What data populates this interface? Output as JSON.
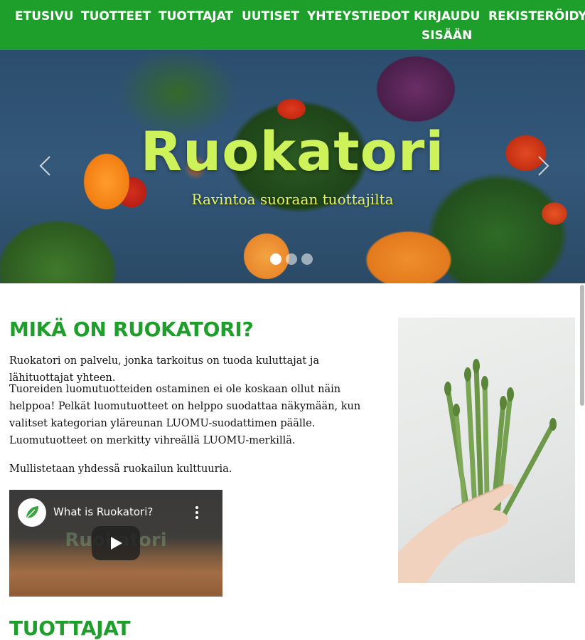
{
  "nav": {
    "items": [
      {
        "label": "ETUSIVU"
      },
      {
        "label": "TUOTTEET"
      },
      {
        "label": "TUOTTAJAT"
      },
      {
        "label": "UUTISET"
      },
      {
        "label": "YHTEYSTIEDOT"
      },
      {
        "label_line1": "KIRJAUDU",
        "label_line2": "SISÄÄN"
      },
      {
        "label": "REKISTERÖIDY"
      }
    ]
  },
  "hero": {
    "title": "Ruokatori",
    "subtitle": "Ravintoa suoraan tuottajilta",
    "slides_total": 3,
    "active_slide": 1
  },
  "about": {
    "heading": "MIKÄ ON RUOKATORI?",
    "paragraphs": [
      "Ruokatori on palvelu, jonka tarkoitus on tuoda kuluttajat ja lähituottajat yhteen.",
      "Tuoreiden luomutuotteiden ostaminen ei ole koskaan ollut näin helppoa! Pelkät luomutuotteet on helppo suodattaa näkymään, kun valitset kategorian yläreunan LUOMU-suodattimen päälle. Luomutuotteet on merkitty vihreällä LUOMU-merkillä.",
      "Mullistetaan yhdessä ruokailun kulttuuria."
    ],
    "video": {
      "title": "What is Ruokatori?",
      "overlay_text": "Ruokatori"
    }
  },
  "producers": {
    "heading": "TUOTTAJAT"
  },
  "colors": {
    "brand_green": "#1e9e2a",
    "hero_title": "#cdf25a",
    "hero_subtitle": "#e6f55a"
  },
  "icons": {
    "prev": "chevron-left-icon",
    "next": "chevron-right-icon",
    "play": "play-icon",
    "more": "more-vertical-icon",
    "logo": "leaf-icon"
  }
}
